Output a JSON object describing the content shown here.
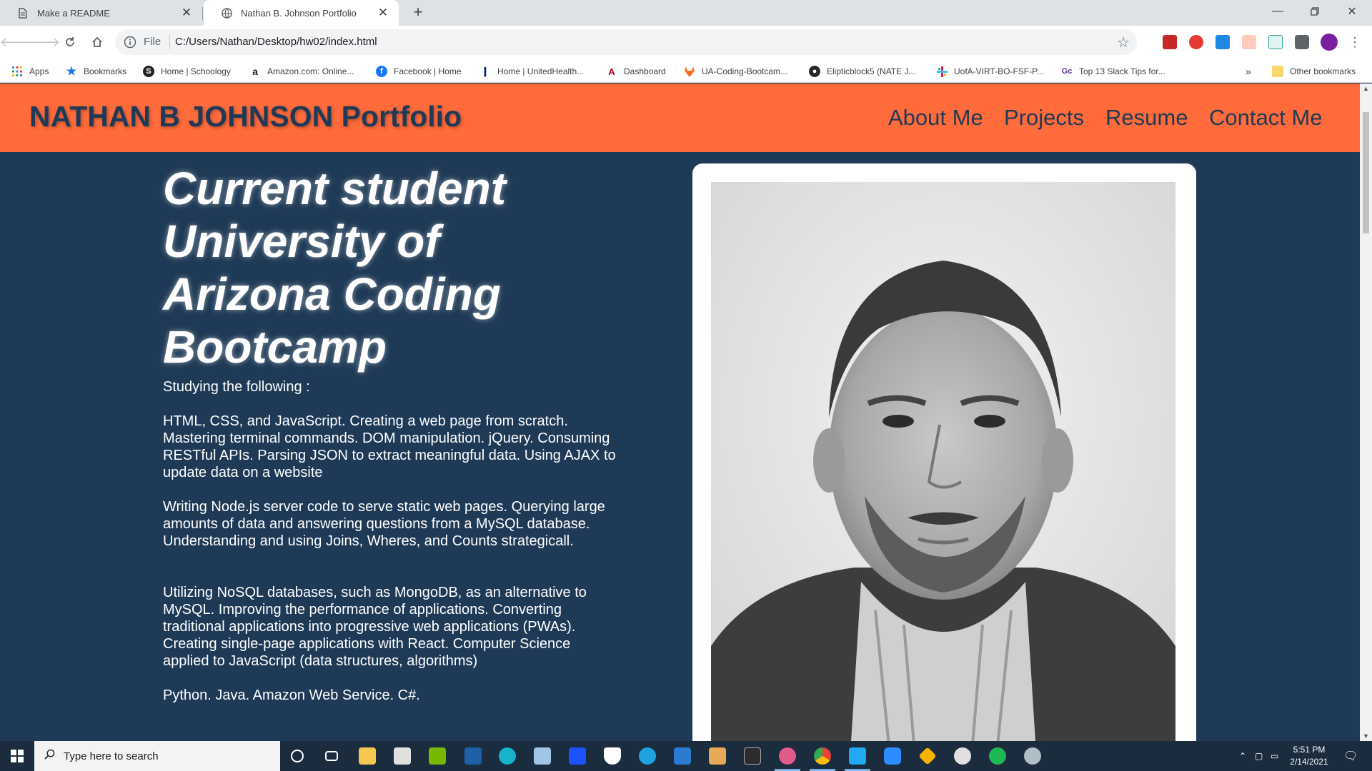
{
  "tabs": [
    {
      "title": "Make a README",
      "icon": "document-icon"
    },
    {
      "title": "Nathan B. Johnson Portfolio",
      "icon": "globe-icon"
    }
  ],
  "address_bar": {
    "scheme_label": "File",
    "url": "C:/Users/Nathan/Desktop/hw02/index.html"
  },
  "bookmarks": [
    {
      "label": "Apps",
      "icon": "apps-grid-icon",
      "color": "#4285f4"
    },
    {
      "label": "Bookmarks",
      "icon": "star-icon",
      "color": "#1a73e8"
    },
    {
      "label": "Home | Schoology",
      "icon": "schoology-icon",
      "color": "#222222"
    },
    {
      "label": "Amazon.com: Online...",
      "icon": "amazon-icon",
      "color": "#222222"
    },
    {
      "label": "Facebook | Home",
      "icon": "facebook-icon",
      "color": "#1877f2"
    },
    {
      "label": "Home | UnitedHealth...",
      "icon": "unitedhealth-icon",
      "color": "#002677"
    },
    {
      "label": "Dashboard",
      "icon": "arizona-icon",
      "color": "#ab0520"
    },
    {
      "label": "UA-Coding-Bootcam...",
      "icon": "gitlab-icon",
      "color": "#fc6d26"
    },
    {
      "label": "Elipticblock5 (NATE J...",
      "icon": "github-icon",
      "color": "#24292e"
    },
    {
      "label": "UofA-VIRT-BO-FSF-P...",
      "icon": "slack-icon",
      "color": "#e01e5a"
    },
    {
      "label": "Top 13 Slack Tips for...",
      "icon": "gc-icon",
      "color": "#5b2e91"
    }
  ],
  "bookmarks_overflow": "»",
  "other_bookmarks": "Other bookmarks",
  "site": {
    "title": "NATHAN B JOHNSON Portfolio",
    "nav": [
      "About Me",
      "Projects",
      "Resume",
      "Contact Me"
    ],
    "hero_lines": [
      "Current student",
      "University of",
      "Arizona Coding",
      "Bootcamp"
    ],
    "intro": "Studying the following :",
    "paragraphs": [
      "HTML, CSS, and JavaScript. Creating a web page from scratch. Mastering terminal commands. DOM manipulation. jQuery. Consuming RESTful APIs. Parsing JSON to extract meaningful data. Using AJAX to update data on a website",
      "Writing Node.js server code to serve static web pages. Querying large amounts of data and answering questions from a MySQL database. Understanding and using Joins, Wheres, and Counts strategicall.",
      "Utilizing NoSQL databases, such as MongoDB, as an alternative to MySQL. Improving the performance of applications. Converting traditional applications into progressive web applications (PWAs). Creating single-page applications with React. Computer Science applied to JavaScript (data structures, algorithms)",
      "Python. Java. Amazon Web Service. C#."
    ],
    "colors": {
      "header": "#ff6b3b",
      "background": "#1f3a56",
      "text_dark": "#1f3a56"
    }
  },
  "taskbar": {
    "search_placeholder": "Type here to search",
    "time": "5:51 PM",
    "date": "2/14/2021"
  }
}
